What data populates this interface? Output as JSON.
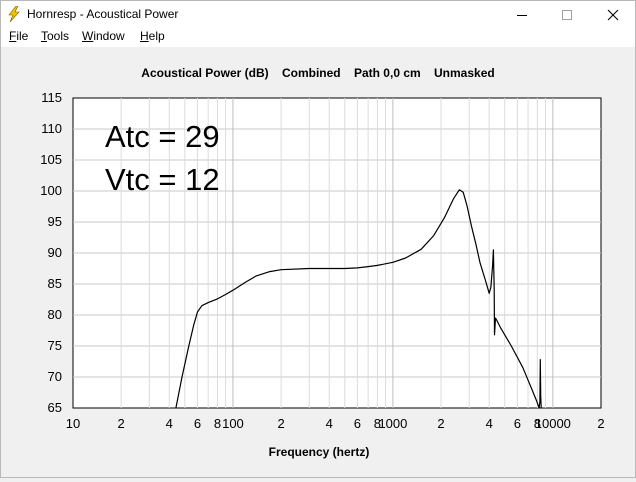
{
  "window": {
    "title": "Hornresp - Acoustical Power",
    "icon": "lightning-bolt-icon"
  },
  "controls": {
    "minimize_icon": "minimize-icon",
    "maximize_icon": "maximize-icon",
    "close_icon": "close-icon"
  },
  "menu": {
    "items": [
      {
        "first": "F",
        "rest": "ile"
      },
      {
        "first": "T",
        "rest": "ools"
      },
      {
        "first": "W",
        "rest": "indow"
      },
      {
        "first": "H",
        "rest": "elp"
      }
    ]
  },
  "chart_data": {
    "type": "line",
    "title": "Acoustical Power (dB)    Combined    Path 0,0 cm    Unmasked",
    "xlabel": "Frequency (hertz)",
    "ylabel": "",
    "xscale": "log",
    "xlim": [
      10,
      20000
    ],
    "ylim": [
      65,
      115
    ],
    "grid": true,
    "yticks": [
      115,
      110,
      105,
      100,
      95,
      90,
      85,
      80,
      75,
      70,
      65
    ],
    "xticks": [
      {
        "v": 10,
        "label": "10"
      },
      {
        "v": 20,
        "label": "2"
      },
      {
        "v": 40,
        "label": "4"
      },
      {
        "v": 60,
        "label": "6"
      },
      {
        "v": 80,
        "label": "8"
      },
      {
        "v": 100,
        "label": "100"
      },
      {
        "v": 200,
        "label": "2"
      },
      {
        "v": 400,
        "label": "4"
      },
      {
        "v": 600,
        "label": "6"
      },
      {
        "v": 800,
        "label": "8"
      },
      {
        "v": 1000,
        "label": "1000"
      },
      {
        "v": 2000,
        "label": "2"
      },
      {
        "v": 4000,
        "label": "4"
      },
      {
        "v": 6000,
        "label": "6"
      },
      {
        "v": 8000,
        "label": "8"
      },
      {
        "v": 10000,
        "label": "10000"
      },
      {
        "v": 20000,
        "label": "2"
      }
    ],
    "annotations": [
      "Atc = 29",
      "Vtc = 12"
    ],
    "series": [
      {
        "color": "#000000",
        "points": [
          [
            44,
            65
          ],
          [
            48,
            70
          ],
          [
            53,
            75
          ],
          [
            57,
            78.5
          ],
          [
            60,
            80.5
          ],
          [
            64,
            81.5
          ],
          [
            70,
            82
          ],
          [
            80,
            82.6
          ],
          [
            90,
            83.3
          ],
          [
            100,
            84
          ],
          [
            120,
            85.3
          ],
          [
            140,
            86.3
          ],
          [
            170,
            87
          ],
          [
            200,
            87.3
          ],
          [
            300,
            87.5
          ],
          [
            400,
            87.5
          ],
          [
            500,
            87.5
          ],
          [
            600,
            87.6
          ],
          [
            700,
            87.8
          ],
          [
            800,
            88
          ],
          [
            1000,
            88.5
          ],
          [
            1200,
            89.2
          ],
          [
            1500,
            90.6
          ],
          [
            1800,
            92.8
          ],
          [
            2100,
            95.7
          ],
          [
            2400,
            98.8
          ],
          [
            2600,
            100.2
          ],
          [
            2750,
            99.8
          ],
          [
            2900,
            97.7
          ],
          [
            3100,
            94.3
          ],
          [
            3300,
            91.5
          ],
          [
            3500,
            88.5
          ],
          [
            3800,
            85.5
          ],
          [
            4000,
            83.5
          ],
          [
            4100,
            84.5
          ],
          [
            4200,
            88
          ],
          [
            4250,
            90.5
          ],
          [
            4300,
            84
          ],
          [
            4320,
            76.8
          ],
          [
            4380,
            79.5
          ],
          [
            4450,
            79.2
          ],
          [
            4700,
            78
          ],
          [
            5500,
            75
          ],
          [
            6500,
            71.5
          ],
          [
            7400,
            68
          ],
          [
            7900,
            66.2
          ],
          [
            8200,
            65
          ],
          [
            8300,
            66
          ],
          [
            8350,
            72.8
          ],
          [
            8400,
            67
          ],
          [
            8450,
            65
          ]
        ]
      }
    ]
  }
}
